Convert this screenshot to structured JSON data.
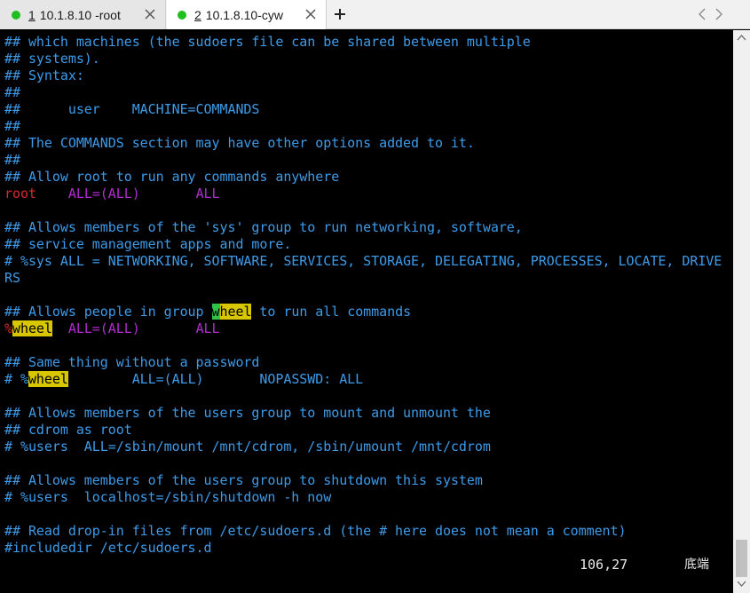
{
  "tabs": [
    {
      "num": "1",
      "title": "10.1.8.10 -root",
      "status_color": "#1fbf1f",
      "active": false
    },
    {
      "num": "2",
      "title": "10.1.8.10-cyw",
      "status_color": "#1fbf1f",
      "active": true
    }
  ],
  "toolbar": {
    "new_tab_icon": "plus-icon",
    "nav_left_icon": "chevron-left-icon",
    "nav_right_icon": "chevron-right-icon"
  },
  "colors": {
    "comment": "#3d9be9",
    "keyword_red": "#d62a2a",
    "magenta": "#b12ccf",
    "search_highlight": "#d7c600",
    "cursor": "#2ec44a"
  },
  "editor": {
    "lines": [
      {
        "t": "## which machines (the sudoers file can be shared between multiple"
      },
      {
        "t": "## systems)."
      },
      {
        "t": "## Syntax:"
      },
      {
        "t": "##"
      },
      {
        "t": "##      user    MACHINE=COMMANDS"
      },
      {
        "t": "##"
      },
      {
        "t": "## The COMMANDS section may have other options added to it."
      },
      {
        "t": "##"
      },
      {
        "t": "## Allow root to run any commands anywhere"
      },
      {
        "a": "root",
        "b": "    ",
        "c": "ALL=(ALL)",
        "d": "       ",
        "e": "ALL"
      },
      {
        "t": ""
      },
      {
        "t": "## Allows members of the 'sys' group to run networking, software,"
      },
      {
        "t": "## service management apps and more."
      },
      {
        "t": "# %sys ALL = NETWORKING, SOFTWARE, SERVICES, STORAGE, DELEGATING, PROCESSES, LOCATE, DRIVE"
      },
      {
        "t": "RS"
      },
      {
        "t": ""
      },
      {
        "a": "## Allows people in group ",
        "cur": "w",
        "hl": "heel",
        "z": " to run all commands"
      },
      {
        "p": "%",
        "hl": "wheel",
        "b": "  ",
        "c": "ALL=(ALL)",
        "d": "       ",
        "e": "ALL"
      },
      {
        "t": ""
      },
      {
        "t": "## Same thing without a password"
      },
      {
        "a": "# %",
        "hl": "wheel",
        "z": "        ALL=(ALL)       NOPASSWD: ALL"
      },
      {
        "t": ""
      },
      {
        "t": "## Allows members of the users group to mount and unmount the"
      },
      {
        "t": "## cdrom as root"
      },
      {
        "t": "# %users  ALL=/sbin/mount /mnt/cdrom, /sbin/umount /mnt/cdrom"
      },
      {
        "t": ""
      },
      {
        "t": "## Allows members of the users group to shutdown this system"
      },
      {
        "t": "# %users  localhost=/sbin/shutdown -h now"
      },
      {
        "t": ""
      },
      {
        "t": "## Read drop-in files from /etc/sudoers.d (the # here does not mean a comment)"
      },
      {
        "t": "#includedir /etc/sudoers.d"
      }
    ],
    "status_position": "106,27",
    "status_scroll": "底端"
  }
}
